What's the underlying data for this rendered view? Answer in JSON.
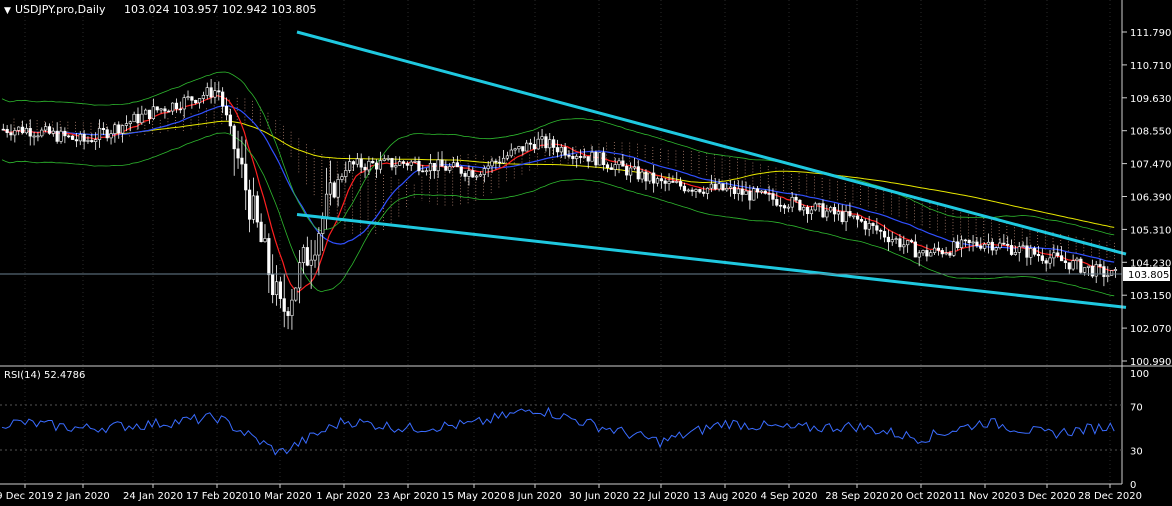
{
  "header": {
    "title": "USDJPY.pro,Daily",
    "ohlc": "103.024 103.957 102.942 103.805"
  },
  "price_axis": {
    "ticks": [
      "111.790",
      "110.710",
      "109.630",
      "108.550",
      "107.470",
      "106.390",
      "105.310",
      "104.230",
      "103.150",
      "102.070",
      "100.990"
    ],
    "current_price": "103.805"
  },
  "indicator": {
    "label": "RSI(14) 52.4786",
    "ticks": [
      "100",
      "70",
      "30",
      "0"
    ]
  },
  "time_axis": {
    "labels": [
      "9 Dec 2019",
      "2 Jan 2020",
      "24 Jan 2020",
      "17 Feb 2020",
      "10 Mar 2020",
      "1 Apr 2020",
      "23 Apr 2020",
      "15 May 2020",
      "8 Jun 2020",
      "30 Jun 2020",
      "22 Jul 2020",
      "13 Aug 2020",
      "4 Sep 2020",
      "28 Sep 2020",
      "20 Oct 2020",
      "11 Nov 2020",
      "3 Dec 2020",
      "28 Dec 2020"
    ]
  },
  "colors": {
    "background": "#000000",
    "bull_candle": "#ffffff",
    "bear_candle": "#ffffff",
    "trendline": "#1fc9e0",
    "ma_slow": "#e6e600",
    "ma_mid": "#3050ff",
    "ma_fast": "#ff2020",
    "bands": "#2eb82e",
    "cloud": "#d9a08a",
    "rsi_line": "#3a6cff",
    "grid": "#2a2a2a",
    "price_label_bg": "#ffffff"
  },
  "chart_data": [
    {
      "type": "candlestick",
      "symbol": "USDJPY",
      "timeframe": "Daily",
      "ylim": [
        100.99,
        112.3
      ],
      "series_close_approx": [
        [
          "9 Dec 2019",
          108.6
        ],
        [
          "2 Jan 2020",
          108.2
        ],
        [
          "24 Jan 2020",
          109.2
        ],
        [
          "17 Feb 2020",
          109.9
        ],
        [
          "10 Mar 2020",
          102.5
        ],
        [
          "1 Apr 2020",
          107.4
        ],
        [
          "23 Apr 2020",
          107.5
        ],
        [
          "15 May 2020",
          107.2
        ],
        [
          "8 Jun 2020",
          108.2
        ],
        [
          "30 Jun 2020",
          107.6
        ],
        [
          "22 Jul 2020",
          106.8
        ],
        [
          "13 Aug 2020",
          106.6
        ],
        [
          "4 Sep 2020",
          106.2
        ],
        [
          "28 Sep 2020",
          105.6
        ],
        [
          "20 Oct 2020",
          104.5
        ],
        [
          "11 Nov 2020",
          104.9
        ],
        [
          "3 Dec 2020",
          104.4
        ],
        [
          "28 Dec 2020",
          103.8
        ]
      ],
      "trendlines": [
        {
          "from": [
            "10 Mar 2020",
            111.79
          ],
          "to": [
            "28 Dec 2020",
            104.5
          ]
        },
        {
          "from": [
            "10 Mar 2020",
            105.8
          ],
          "to": [
            "28 Dec 2020",
            102.75
          ]
        }
      ]
    },
    {
      "type": "line",
      "name": "RSI(14)",
      "last_value": 52.4786,
      "ylim": [
        0,
        100
      ],
      "levels": [
        70,
        30
      ],
      "x_approx": [
        "9 Dec 2019",
        "2 Jan 2020",
        "24 Jan 2020",
        "17 Feb 2020",
        "10 Mar 2020",
        "1 Apr 2020",
        "23 Apr 2020",
        "15 May 2020",
        "8 Jun 2020",
        "30 Jun 2020",
        "22 Jul 2020",
        "13 Aug 2020",
        "4 Sep 2020",
        "28 Sep 2020",
        "20 Oct 2020",
        "11 Nov 2020",
        "3 Dec 2020",
        "28 Dec 2020"
      ],
      "values_approx": [
        55,
        50,
        54,
        60,
        28,
        57,
        50,
        54,
        68,
        52,
        38,
        55,
        50,
        52,
        41,
        56,
        45,
        52
      ]
    }
  ]
}
